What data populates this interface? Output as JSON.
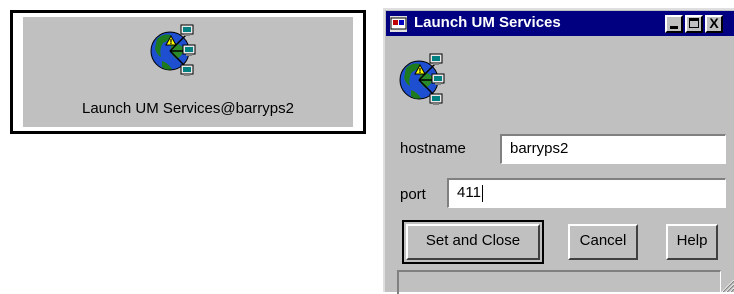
{
  "launcher": {
    "label": "Launch UM Services@barryps2",
    "icon": "network-globe-icon"
  },
  "window": {
    "title": "Launch UM Services",
    "title_icon": "app-icon",
    "controls": {
      "minimize": "minimize-icon",
      "maximize": "maximize-icon",
      "close": "close-icon",
      "close_glyph": "X"
    },
    "dialog_icon": "network-globe-icon"
  },
  "form": {
    "hostname": {
      "label": "hostname",
      "value": "barryps2"
    },
    "port": {
      "label": "port",
      "value": "411"
    }
  },
  "buttons": {
    "set_and_close": "Set and Close",
    "cancel": "Cancel",
    "help": "Help"
  },
  "colors": {
    "titlebar": "#000080",
    "face": "#c0c0c0",
    "field_bg": "#ffffff"
  }
}
